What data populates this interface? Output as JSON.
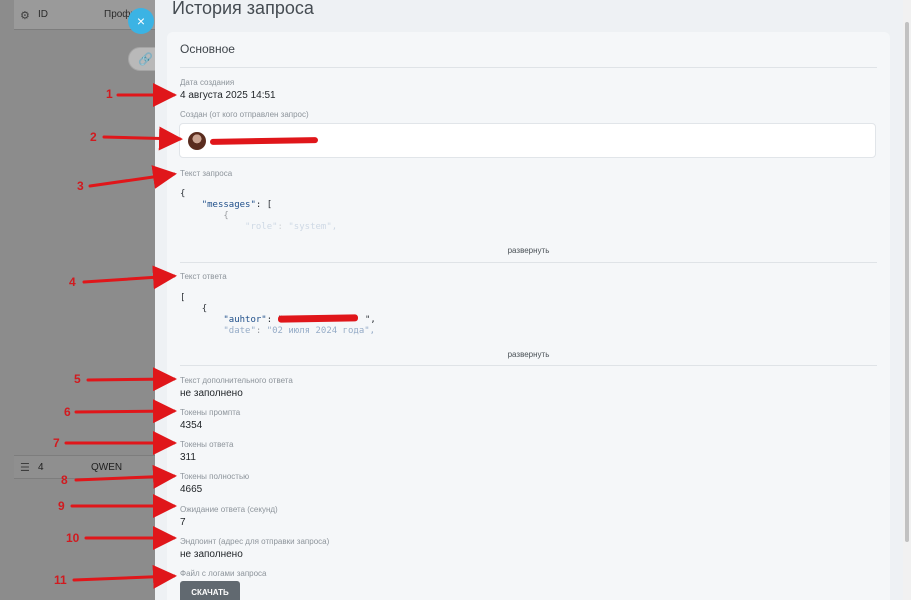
{
  "background": {
    "header_id": "ID",
    "header_profile": "Профиль",
    "row_number": "4",
    "row_name": "QWEN"
  },
  "drawer": {
    "title": "История запроса",
    "section_title": "Основное",
    "close_symbol": "×",
    "fields": {
      "created_date": {
        "label": "Дата создания",
        "value": "4 августа 2025 14:51"
      },
      "created_by": {
        "label": "Создан (от кого отправлен запрос)"
      },
      "request_text": {
        "label": "Текст запроса",
        "expand": "развернуть"
      },
      "response_text": {
        "label": "Текст ответа",
        "expand": "развернуть"
      },
      "extra_response": {
        "label": "Текст дополнительного ответа",
        "value": "не заполнено"
      },
      "prompt_tokens": {
        "label": "Токены промпта",
        "value": "4354"
      },
      "response_tokens": {
        "label": "Токены ответа",
        "value": "311"
      },
      "total_tokens": {
        "label": "Токены полностью",
        "value": "4665"
      },
      "wait_seconds": {
        "label": "Ожидание ответа (секунд)",
        "value": "7"
      },
      "endpoint": {
        "label": "Эндпоинт (адрес для отправки запроса)",
        "value": "не заполнено"
      },
      "log_file": {
        "label": "Файл с логами запроса",
        "button": "СКАЧАТЬ"
      }
    },
    "request_code": {
      "line1": "{",
      "line2_key": "\"messages\"",
      "line2_rest": ": [",
      "line3": "{",
      "line4_key": "\"role\"",
      "line4_value": "\"system\","
    },
    "response_code": {
      "line1": "[",
      "line2": "{",
      "line3_key": "\"auhtor\"",
      "line3_rest": ": \"",
      "line3_end": "\",",
      "line4_key": "\"date\"",
      "line4_value": "\"02 июля 2024 года\","
    }
  },
  "annotations": [
    "1",
    "2",
    "3",
    "4",
    "5",
    "6",
    "7",
    "8",
    "9",
    "10",
    "11"
  ],
  "colors": {
    "accent": "#3bb3e4",
    "annotation": "#e0161a",
    "button": "#616970"
  }
}
